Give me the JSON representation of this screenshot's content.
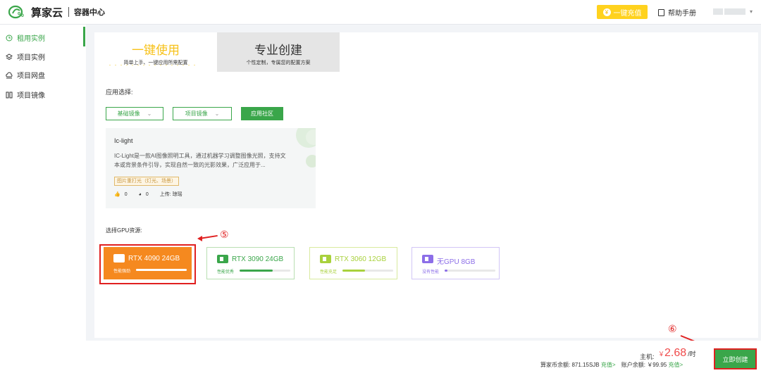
{
  "brand": {
    "name": "算家云",
    "sub": "容器中心"
  },
  "topbar": {
    "recharge_label": "一键充值",
    "help_label": "帮助手册"
  },
  "sidebar": {
    "items": [
      {
        "label": "租用实例",
        "active": true
      },
      {
        "label": "项目实例"
      },
      {
        "label": "项目网盘"
      },
      {
        "label": "项目镜像"
      }
    ]
  },
  "mode_tabs": [
    {
      "title": "一键使用",
      "sub": "简单上手、一键应用所需配置",
      "active": true
    },
    {
      "title": "专业创建",
      "sub": "个性定制，专属您的配置方案",
      "active": false
    }
  ],
  "app_select": {
    "label": "应用选择:",
    "filters": [
      {
        "label": "基础镜像",
        "type": "dropdown"
      },
      {
        "label": "项目镜像",
        "type": "dropdown"
      },
      {
        "label": "应用社区",
        "type": "selected"
      }
    ]
  },
  "app_card": {
    "title": "Ic-light",
    "desc": "IC-Light是一款AI图像照明工具，通过机器学习调整图像光照，支持文本或背景条件引导，实现自然一致的光影效果，广泛应用于...",
    "tag": "图片重打光（灯光、场景）",
    "likes": "0",
    "uses": "0",
    "uploader": "上传: 琼瑶"
  },
  "gpu_section": {
    "label": "选择GPU资源:",
    "options": [
      {
        "name": "RTX 4090  24GB",
        "perf": "性能强劲",
        "level": 1.0,
        "selected": true,
        "color": "#f5891f"
      },
      {
        "name": "RTX 3090  24GB",
        "perf": "性能优秀",
        "level": 0.65,
        "selected": false,
        "color": "#3aa64a"
      },
      {
        "name": "RTX 3060  12GB",
        "perf": "性能充足",
        "level": 0.45,
        "selected": false,
        "color": "#a8d13c"
      },
      {
        "name": "无GPU    8GB",
        "perf": "没有性能",
        "level": 0.05,
        "selected": false,
        "color": "#8c6ee8"
      }
    ]
  },
  "annotations": {
    "step5": "⑤",
    "step6": "⑥"
  },
  "footer": {
    "price_label": "主机:",
    "price_currency": "￥",
    "price_value": "2.68",
    "price_unit": "/时",
    "coin_balance_label": "算家币余额:",
    "coin_balance": "871.15SJB",
    "coin_recharge": "充值>",
    "account_balance_label": "账户余额:",
    "account_balance": "￥99.95",
    "account_recharge": "充值>",
    "create_label": "立即创建"
  },
  "colors": {
    "brand_green": "#3aa64a",
    "accent_orange": "#f5891f",
    "annotation_red": "#e02020",
    "recharge_yellow": "#ffd21e"
  }
}
